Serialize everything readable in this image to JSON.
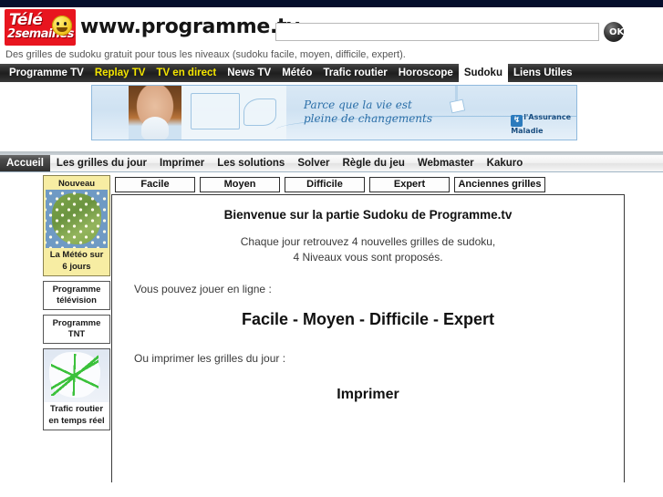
{
  "header": {
    "logo_line1": "Télé",
    "logo_line2": "2semaines",
    "site_name": "www.programme.tv",
    "search_value": "",
    "search_placeholder": "",
    "ok_label": "OK"
  },
  "tagline": "Des grilles de sudoku gratuit pour tous les niveaux (sudoku facile, moyen, difficile, expert).",
  "main_nav": [
    {
      "label": "Programme TV",
      "style": "normal",
      "active": false
    },
    {
      "label": "Replay TV",
      "style": "highlight",
      "active": false
    },
    {
      "label": "TV en direct",
      "style": "highlight",
      "active": false
    },
    {
      "label": "News TV",
      "style": "normal",
      "active": false
    },
    {
      "label": "Météo",
      "style": "normal",
      "active": false
    },
    {
      "label": "Trafic routier",
      "style": "normal",
      "active": false
    },
    {
      "label": "Horoscope",
      "style": "normal",
      "active": false
    },
    {
      "label": "Sudoku",
      "style": "normal",
      "active": true
    },
    {
      "label": "Liens Utiles",
      "style": "normal",
      "active": false
    }
  ],
  "banner": {
    "text_line1": "Parce que la vie est",
    "text_line2": "pleine de changements",
    "advertiser_mark": "↯",
    "advertiser_line1": "l'Assurance",
    "advertiser_line2": "Maladie"
  },
  "sub_nav": [
    {
      "label": "Accueil",
      "active": true
    },
    {
      "label": "Les grilles du jour",
      "active": false
    },
    {
      "label": "Imprimer",
      "active": false
    },
    {
      "label": "Les solutions",
      "active": false
    },
    {
      "label": "Solver",
      "active": false
    },
    {
      "label": "Règle du jeu",
      "active": false
    },
    {
      "label": "Webmaster",
      "active": false
    },
    {
      "label": "Kakuro",
      "active": false
    }
  ],
  "difficulty_tabs": [
    {
      "label": "Facile"
    },
    {
      "label": "Moyen"
    },
    {
      "label": "Difficile"
    },
    {
      "label": "Expert"
    },
    {
      "label": "Anciennes grilles"
    }
  ],
  "sidebar": {
    "meteo": {
      "badge": "Nouveau",
      "caption_line1": "La Météo sur",
      "caption_line2": "6 jours"
    },
    "tv": {
      "line1": "Programme",
      "line2": "télévision"
    },
    "tnt": {
      "line1": "Programme",
      "line2": "TNT"
    },
    "trafic": {
      "caption_line1": "Trafic routier",
      "caption_line2": "en temps réel"
    }
  },
  "content": {
    "welcome": "Bienvenue sur la partie Sudoku de Programme.tv",
    "intro_line1": "Chaque jour retrouvez 4 nouvelles grilles de sudoku,",
    "intro_line2": "4 Niveaux vous sont proposés.",
    "play_line": "Vous pouvez jouer en ligne :",
    "levels": "Facile - Moyen - Difficile - Expert",
    "print_line": "Ou imprimer les grilles du jour :",
    "print_word": "Imprimer"
  },
  "colors": {
    "topbar": "#050f2c",
    "nav_highlight": "#f4e500",
    "logo_red": "#e8151f",
    "meteo_yellow": "#f7eda3"
  }
}
